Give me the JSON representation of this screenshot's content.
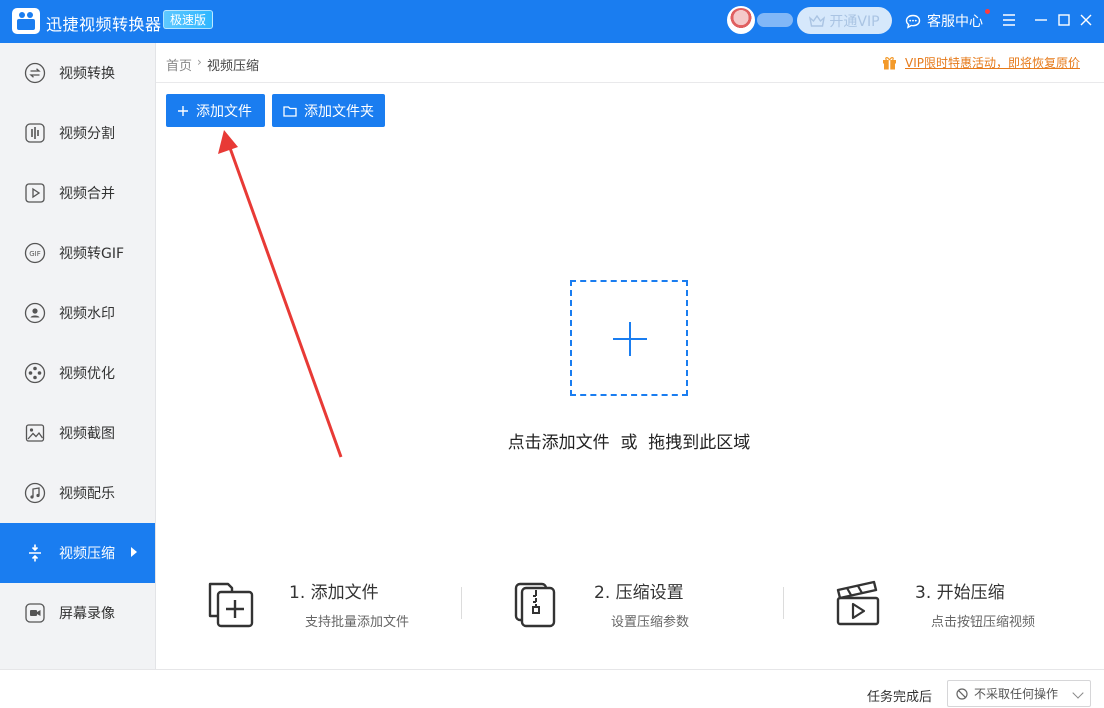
{
  "app": {
    "title": "迅捷视频转换器",
    "edition": "极速版",
    "vip_button": "开通VIP",
    "service": "客服中心",
    "brand_color": "#1a7df0"
  },
  "sidebar": {
    "items": [
      {
        "label": "视频转换",
        "icon": "convert-icon",
        "active": false
      },
      {
        "label": "视频分割",
        "icon": "split-icon",
        "active": false
      },
      {
        "label": "视频合并",
        "icon": "merge-icon",
        "active": false
      },
      {
        "label": "视频转GIF",
        "icon": "gif-icon",
        "active": false
      },
      {
        "label": "视频水印",
        "icon": "watermark-icon",
        "active": false
      },
      {
        "label": "视频优化",
        "icon": "optimize-icon",
        "active": false
      },
      {
        "label": "视频截图",
        "icon": "screenshot-icon",
        "active": false
      },
      {
        "label": "视频配乐",
        "icon": "music-icon",
        "active": false
      },
      {
        "label": "视频压缩",
        "icon": "compress-icon",
        "active": true
      },
      {
        "label": "屏幕录像",
        "icon": "record-icon",
        "active": false
      }
    ]
  },
  "breadcrumb": {
    "home": "首页",
    "separator": "›",
    "current": "视频压缩"
  },
  "promo": {
    "text": "VIP限时特惠活动，即将恢复原价",
    "color": "#e67a1a"
  },
  "toolbar": {
    "add_file": "添加文件",
    "add_folder": "添加文件夹"
  },
  "dropzone": {
    "hint": "点击添加文件  或  拖拽到此区域"
  },
  "steps": [
    {
      "title": "1. 添加文件",
      "desc": "支持批量添加文件",
      "icon": "add-file-icon"
    },
    {
      "title": "2. 压缩设置",
      "desc": "设置压缩参数",
      "icon": "compress-settings-icon"
    },
    {
      "title": "3. 开始压缩",
      "desc": "点击按钮压缩视频",
      "icon": "clapperboard-icon"
    }
  ],
  "footer": {
    "label": "任务完成后",
    "select_value": "不采取任何操作"
  },
  "annotation": {
    "arrow_color": "#e83a36"
  }
}
